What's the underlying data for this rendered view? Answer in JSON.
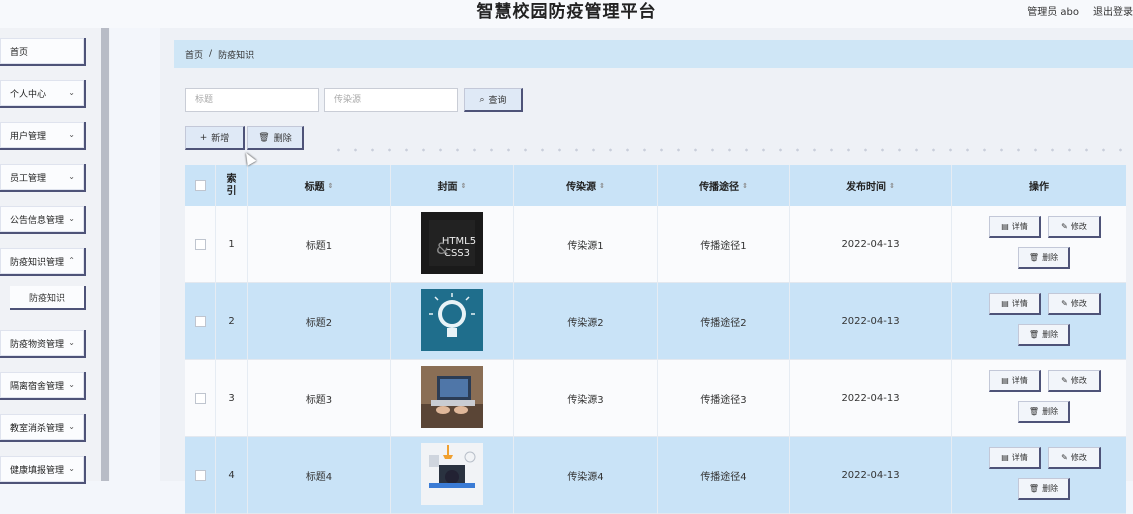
{
  "app": {
    "title": "智慧校园防疫管理平台"
  },
  "user": {
    "label": "管理员 abo",
    "logout": "退出登录"
  },
  "sidebar": {
    "items": [
      {
        "label": "首页",
        "has_children": false
      },
      {
        "label": "个人中心",
        "has_children": true
      },
      {
        "label": "用户管理",
        "has_children": true
      },
      {
        "label": "员工管理",
        "has_children": true
      },
      {
        "label": "公告信息管理",
        "has_children": true
      },
      {
        "label": "防疫知识管理",
        "has_children": true
      },
      {
        "label": "防疫物资管理",
        "has_children": true
      },
      {
        "label": "隔离宿舍管理",
        "has_children": true
      },
      {
        "label": "教室消杀管理",
        "has_children": true
      },
      {
        "label": "健康填报管理",
        "has_children": true
      }
    ],
    "sub_item": "防疫知识"
  },
  "breadcrumb": {
    "home": "首页",
    "sep": "/",
    "current": "防疫知识"
  },
  "search": {
    "title_placeholder": "标题",
    "source_placeholder": "传染源",
    "button": "查询"
  },
  "toolbar": {
    "add": "新增",
    "delete": "删除"
  },
  "table": {
    "headers": {
      "index": "索\n引",
      "title": "标题",
      "cover": "封面",
      "source": "传染源",
      "route": "传播途径",
      "time": "发布时间",
      "ops": "操作"
    },
    "rows": [
      {
        "index": "1",
        "title": "标题1",
        "source": "传染源1",
        "route": "传播途径1",
        "time": "2022-04-13",
        "cover": "html5-css3"
      },
      {
        "index": "2",
        "title": "标题2",
        "source": "传染源2",
        "route": "传播途径2",
        "time": "2022-04-13",
        "cover": "lightbulb-idea"
      },
      {
        "index": "3",
        "title": "标题3",
        "source": "传染源3",
        "route": "传播途径3",
        "time": "2022-04-13",
        "cover": "laptop-typing"
      },
      {
        "index": "4",
        "title": "标题4",
        "source": "传染源4",
        "route": "传播途径4",
        "time": "2022-04-13",
        "cover": "desk-workspace"
      }
    ],
    "op_labels": {
      "detail": "详情",
      "edit": "修改",
      "delete": "删除"
    }
  },
  "colors": {
    "accent": "#4e5378",
    "header_bg": "#c9e3f7",
    "row_alt": "#c9e3f7"
  }
}
